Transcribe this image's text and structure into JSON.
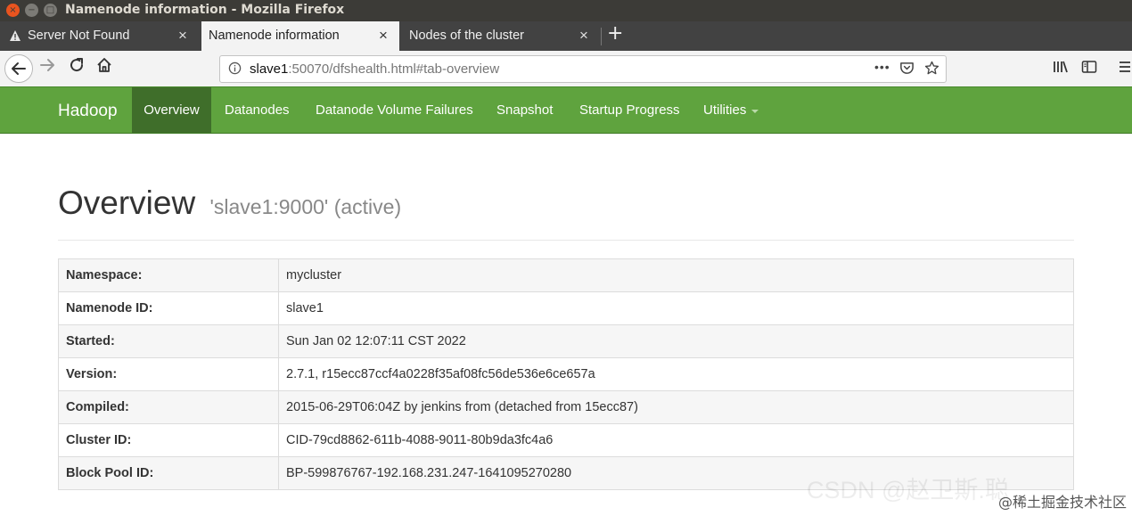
{
  "window": {
    "title": "Namenode information - Mozilla Firefox",
    "close_glyph": "×",
    "min_glyph": "−",
    "max_glyph": "□"
  },
  "tabs": [
    {
      "label": "Server Not Found",
      "icon": "warning-icon",
      "active": false
    },
    {
      "label": "Namenode information",
      "active": true
    },
    {
      "label": "Nodes of the cluster",
      "active": false
    }
  ],
  "tab_close_glyph": "×",
  "new_tab_glyph": "+",
  "url": {
    "host": "slave1",
    "rest": ":50070/dfshealth.html#tab-overview",
    "more_glyph": "•••"
  },
  "hadoop": {
    "brand": "Hadoop",
    "nav": [
      "Overview",
      "Datanodes",
      "Datanode Volume Failures",
      "Snapshot",
      "Startup Progress",
      "Utilities"
    ],
    "active": "Overview"
  },
  "overview": {
    "title": "Overview",
    "subtitle": "'slave1:9000' (active)",
    "rows": [
      {
        "key": "Namespace:",
        "value": "mycluster"
      },
      {
        "key": "Namenode ID:",
        "value": "slave1"
      },
      {
        "key": "Started:",
        "value": "Sun Jan 02 12:07:11 CST 2022"
      },
      {
        "key": "Version:",
        "value": "2.7.1, r15ecc87ccf4a0228f35af08fc56de536e6ce657a"
      },
      {
        "key": "Compiled:",
        "value": "2015-06-29T06:04Z by jenkins from (detached from 15ecc87)"
      },
      {
        "key": "Cluster ID:",
        "value": "CID-79cd8862-611b-4088-9011-80b9da3fc4a6"
      },
      {
        "key": "Block Pool ID:",
        "value": "BP-599876767-192.168.231.247-1641095270280"
      }
    ]
  },
  "watermark": {
    "faint": "CSDN @赵卫斯.聪",
    "main": "@稀土掘金技术社区"
  },
  "colors": {
    "hadoop_green": "#5fa33e",
    "hadoop_active": "#3f6e2a",
    "titlebar": "#3c3b37",
    "tabstrip": "#424242"
  }
}
